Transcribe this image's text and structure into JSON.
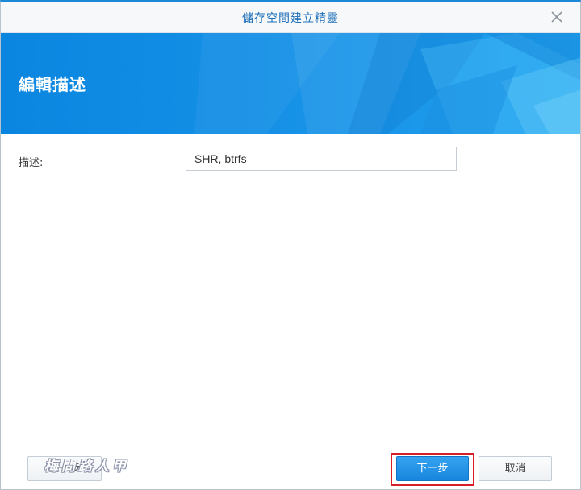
{
  "window": {
    "title": "儲存空間建立精靈"
  },
  "banner": {
    "title": "編輯描述"
  },
  "form": {
    "description_label": "描述:",
    "description_value": "SHR, btrfs"
  },
  "footer": {
    "back_label": "上一步",
    "next_label": "下一步",
    "cancel_label": "取消"
  },
  "watermark": {
    "text": "梅問路人甲"
  },
  "colors": {
    "accent": "#1e88d8",
    "banner": "#1590e6",
    "primary_button": "#1785dd",
    "highlight": "#d61f26"
  },
  "icons": {
    "close": "close-icon"
  }
}
